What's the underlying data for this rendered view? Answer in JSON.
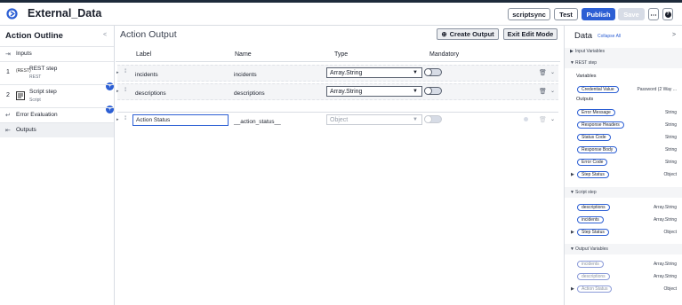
{
  "app": {
    "title": "External_Data"
  },
  "header": {
    "scriptsync": "scriptsync",
    "test": "Test",
    "publish": "Publish",
    "save": "Save",
    "more": "⋯",
    "help": "?"
  },
  "outline": {
    "title": "Action Outline",
    "inputs": "Inputs",
    "steps": [
      {
        "num": "1",
        "name": "REST step",
        "sub": "REST",
        "icon": "(REST)"
      },
      {
        "num": "2",
        "name": "Script step",
        "sub": "Script",
        "icon": "[]"
      }
    ],
    "error": "Error Evaluation",
    "outputs": "Outputs"
  },
  "center": {
    "title": "Action Output",
    "create_output": "Create Output",
    "exit_edit": "Exit Edit Mode",
    "columns": {
      "label": "Label",
      "name": "Name",
      "type": "Type",
      "mandatory": "Mandatory"
    },
    "rows": [
      {
        "label": "incidents",
        "name": "incidents",
        "type": "Array.String"
      },
      {
        "label": "descriptions",
        "name": "descriptions",
        "type": "Array.String"
      },
      {
        "label": "Action Status",
        "name": "__action_status__",
        "type": "Object"
      }
    ]
  },
  "data": {
    "title": "Data",
    "collapse_all": "Collapse All",
    "input_variables": "Input Variables",
    "rest_step": "REST step",
    "variables": "Variables",
    "credential_value": "Credential Value",
    "credential_type": "Password (2 Way ...",
    "outputs": "Outputs",
    "rest_outputs": [
      {
        "name": "Error Message",
        "type": "String"
      },
      {
        "name": "Response Headers",
        "type": "String"
      },
      {
        "name": "Status Code",
        "type": "String"
      },
      {
        "name": "Response Body",
        "type": "String"
      },
      {
        "name": "Error Code",
        "type": "String"
      },
      {
        "name": "Step Status",
        "type": "Object"
      }
    ],
    "script_step": "Script step",
    "script_outputs": [
      {
        "name": "descriptions",
        "type": "Array.String"
      },
      {
        "name": "incidents",
        "type": "Array.String"
      },
      {
        "name": "Step Status",
        "type": "Object"
      }
    ],
    "output_variables": "Output Variables",
    "output_vars": [
      {
        "name": "incidents",
        "type": "Array.String"
      },
      {
        "name": "descriptions",
        "type": "Array.String"
      },
      {
        "name": "Action Status",
        "type": "Object"
      }
    ]
  }
}
